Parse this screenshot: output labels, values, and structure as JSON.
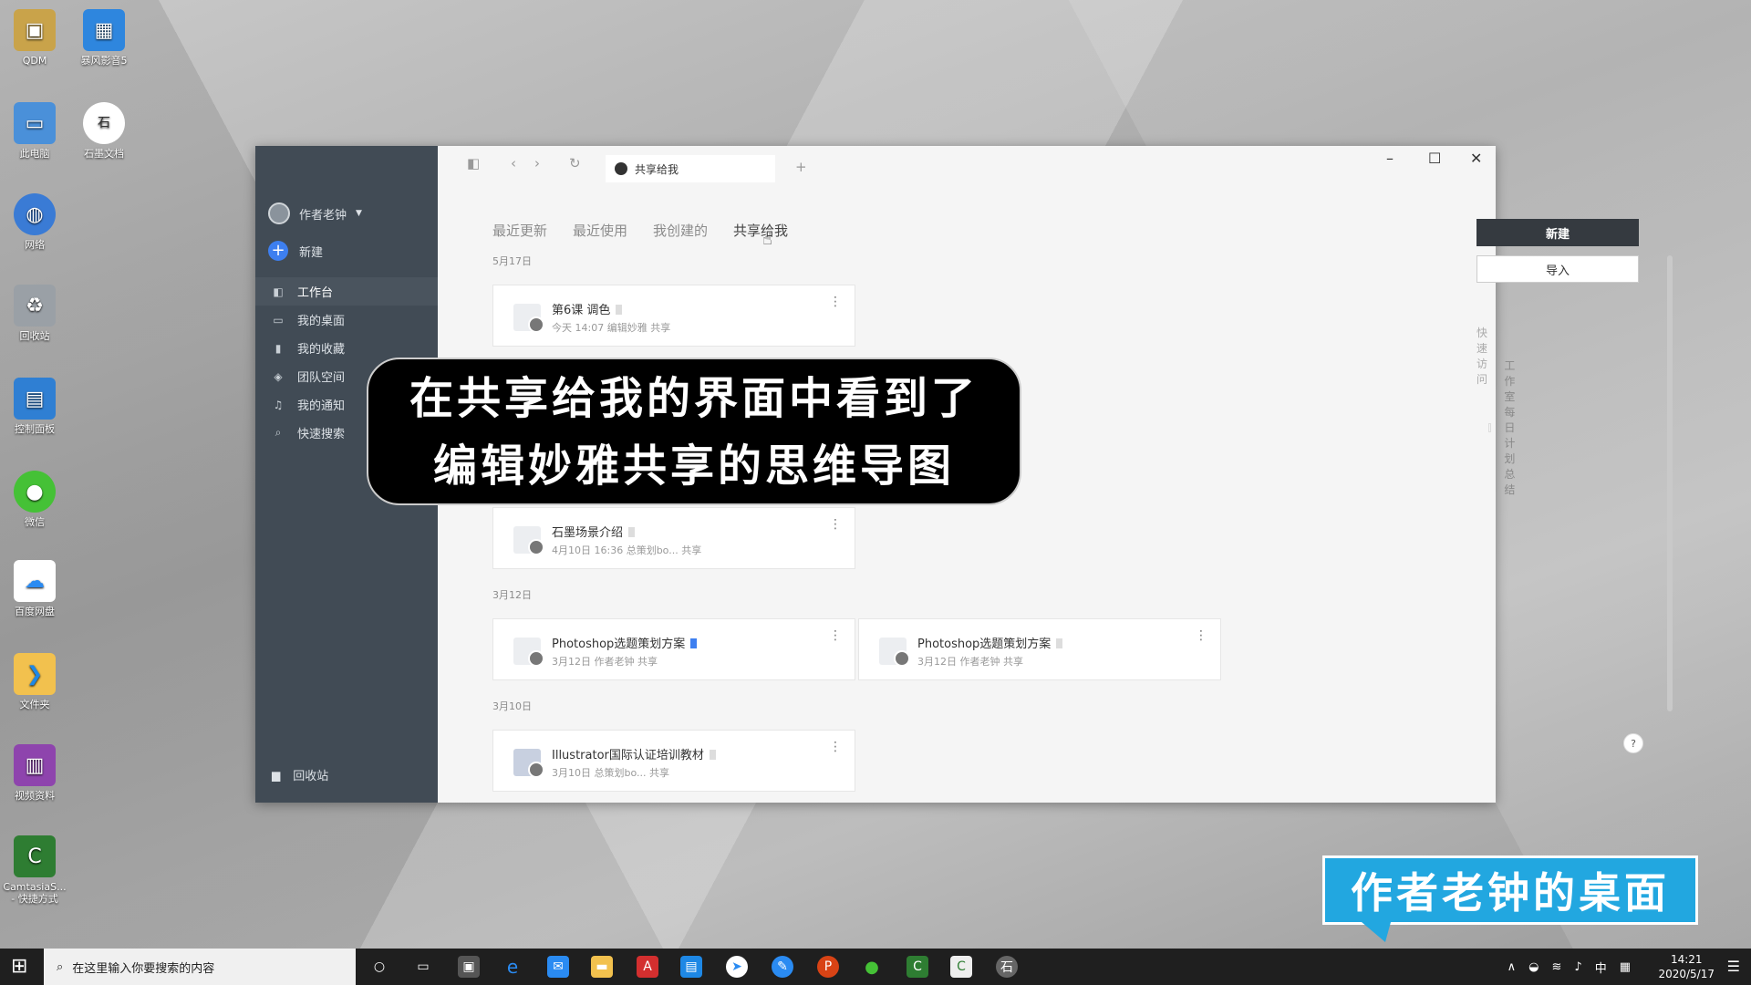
{
  "desktop_icons": [
    {
      "label": "QDM",
      "icon": "qdm-icon",
      "color": "#c9a34a"
    },
    {
      "label": "暴风影音5",
      "icon": "baofeng-icon",
      "color": "#2e86de"
    },
    {
      "label": "此电脑",
      "icon": "computer-icon",
      "color": "#4a90d9"
    },
    {
      "label": "石墨文档",
      "icon": "shimo-icon",
      "color": "#ffffff"
    },
    {
      "label": "网络",
      "icon": "network-icon",
      "color": "#3a7bd5"
    },
    {
      "label": "回收站",
      "icon": "recycle-bin-icon",
      "color": "#9aa0a6"
    },
    {
      "label": "控制面板",
      "icon": "control-panel-icon",
      "color": "#2f7fd3"
    },
    {
      "label": "微信",
      "icon": "wechat-icon",
      "color": "#45c136"
    },
    {
      "label": "百度网盘",
      "icon": "baidu-netdisk-icon",
      "color": "#2a8bf2"
    },
    {
      "label": "文件夹",
      "icon": "folder-app-icon",
      "color": "#1e88e5"
    },
    {
      "label": "视频资料",
      "icon": "winrar-icon",
      "color": "#8e44ad"
    },
    {
      "label": "CamtasiaS...",
      "label2": "- 快捷方式",
      "icon": "camtasia-icon",
      "color": "#2e7d32"
    }
  ],
  "window": {
    "user_name": "作者老钟",
    "new_label": "新建",
    "nav": [
      {
        "label": "工作台",
        "icon": "workbench-icon"
      },
      {
        "label": "我的桌面",
        "icon": "desktop-icon"
      },
      {
        "label": "我的收藏",
        "icon": "bookmark-icon"
      },
      {
        "label": "团队空间",
        "icon": "team-icon"
      },
      {
        "label": "我的通知",
        "icon": "bell-icon"
      },
      {
        "label": "快速搜索",
        "icon": "search-icon"
      }
    ],
    "trash_label": "回收站",
    "tab_title": "共享给我",
    "filter_tabs": [
      "最近更新",
      "最近使用",
      "我创建的",
      "共享给我"
    ],
    "active_filter": 3,
    "groups": [
      {
        "date": "5月17日",
        "files": [
          {
            "name": "第6课 调色",
            "meta": "今天 14:07 编辑妙雅 共享",
            "starred": false
          }
        ]
      },
      {
        "date": "",
        "files": [
          {
            "name": "石墨场景介绍",
            "meta": "4月10日 16:36 总策划bo... 共享",
            "starred": false
          }
        ]
      },
      {
        "date": "3月12日",
        "files": [
          {
            "name": "Photoshop选题策划方案",
            "meta": "3月12日 作者老钟 共享",
            "starred": true
          },
          {
            "name": "Photoshop选题策划方案",
            "meta": "3月12日 作者老钟 共享",
            "starred": false
          }
        ]
      },
      {
        "date": "3月10日",
        "files": [
          {
            "name": "Illustrator国际认证培训教材",
            "meta": "3月10日 总策划bo... 共享",
            "starred": false
          }
        ]
      }
    ],
    "btn_new": "新建",
    "btn_import": "导入",
    "quick_access_title": "快速访问",
    "quick_access_item": "工作室每日计划总结",
    "help_label": "?"
  },
  "caption": {
    "line1": "在共享给我的界面中看到了",
    "line2": "编辑妙雅共享的思维导图"
  },
  "tag_text": "作者老钟的桌面",
  "taskbar": {
    "search_placeholder": "在这里输入你要搜索的内容",
    "ime": "中",
    "time": "14:21",
    "date": "2020/5/17"
  }
}
